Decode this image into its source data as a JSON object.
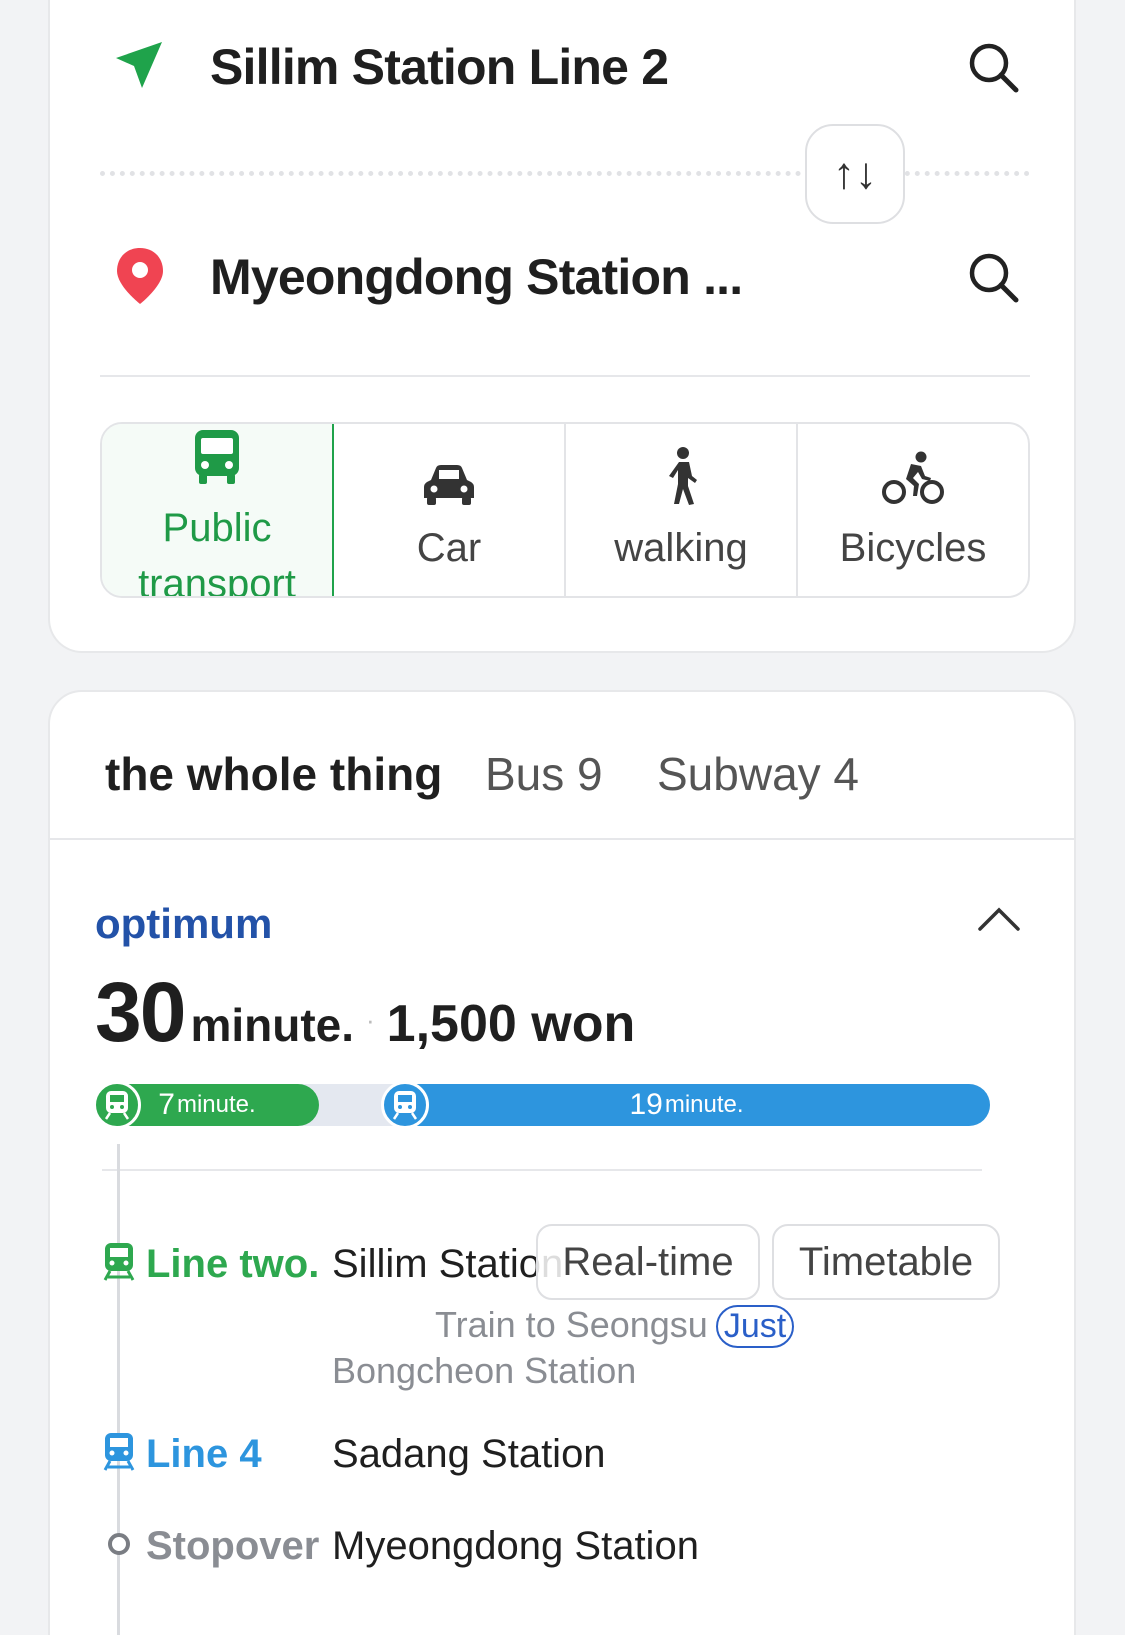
{
  "route": {
    "origin": "Sillim Station Line 2",
    "destination": "Myeongdong Station ...",
    "swap_icon": "↑↓"
  },
  "modes": [
    {
      "label": "Public transport",
      "icon": "bus-icon",
      "active": true
    },
    {
      "label": "Car",
      "icon": "car-icon",
      "active": false
    },
    {
      "label": "walking",
      "icon": "walking-icon",
      "active": false
    },
    {
      "label": "Bicycles",
      "icon": "bicycle-icon",
      "active": false
    }
  ],
  "tabs": {
    "all": "the whole thing",
    "bus": "Bus 9",
    "subway": "Subway  4"
  },
  "result": {
    "label": "optimum",
    "duration": "30",
    "duration_unit": "minute.",
    "separator": "·",
    "fare": "1,500 won",
    "segments": [
      {
        "minutes": "7",
        "unit": "minute.",
        "color": "#2ea84f"
      },
      {
        "minutes": "19",
        "unit": "minute.",
        "color": "#2d95de"
      }
    ]
  },
  "steps": {
    "line_two": "Line two.",
    "origin_station": "Sillim Station",
    "realtime_label": "Real-time",
    "timetable_label": "Timetable",
    "train_direction": "Train to Seongsu",
    "just": "Just",
    "next_station": "Bongcheon Station",
    "line_four": "Line 4",
    "transfer_station": "Sadang Station",
    "stopover_label": "Stopover",
    "destination_station": "Myeongdong Station"
  },
  "colors": {
    "accent_green": "#1fa34b",
    "line2_green": "#2ea84f",
    "line4_blue": "#2d95de",
    "optimum_blue": "#2352a8",
    "destination_red": "#f04452"
  }
}
